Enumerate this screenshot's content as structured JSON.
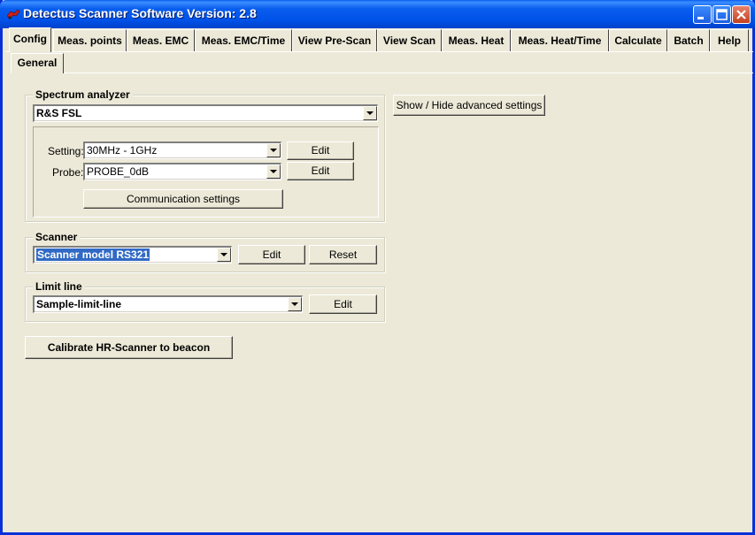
{
  "window": {
    "title": "Detectus Scanner Software Version: 2.8",
    "icon": "app-icon"
  },
  "main_tabs": [
    {
      "label": "Config",
      "active": true
    },
    {
      "label": "Meas. points"
    },
    {
      "label": "Meas. EMC"
    },
    {
      "label": "Meas. EMC/Time"
    },
    {
      "label": "View Pre-Scan"
    },
    {
      "label": "View Scan"
    },
    {
      "label": "Meas. Heat"
    },
    {
      "label": "Meas. Heat/Time"
    },
    {
      "label": "Calculate"
    },
    {
      "label": "Batch"
    },
    {
      "label": "Help"
    }
  ],
  "sub_tabs": [
    {
      "label": "General",
      "active": true
    }
  ],
  "spectrum": {
    "group_label": "Spectrum analyzer",
    "analyzer_value": "R&S FSL",
    "setting_label": "Setting:",
    "setting_value": "30MHz - 1GHz",
    "probe_label": "Probe:",
    "probe_value": "PROBE_0dB",
    "edit_label": "Edit",
    "communication_label": "Communication settings"
  },
  "advanced_button": "Show / Hide advanced settings",
  "scanner": {
    "group_label": "Scanner",
    "model_value": "Scanner model RS321",
    "edit_label": "Edit",
    "reset_label": "Reset"
  },
  "limit": {
    "group_label": "Limit line",
    "value": "Sample-limit-line",
    "edit_label": "Edit"
  },
  "calibrate_button": "Calibrate HR-Scanner to beacon",
  "colors": {
    "titlebar": "#0052e8",
    "face": "#ece9d8",
    "selection": "#316ac5"
  }
}
